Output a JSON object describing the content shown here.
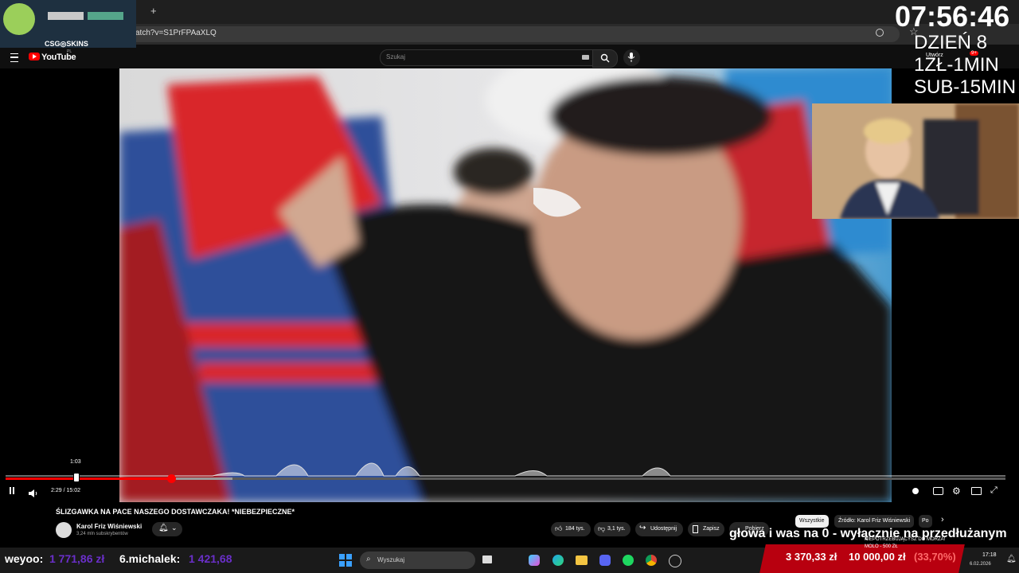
{
  "browser": {
    "url_fragment": "atch?v=S1PrFPAaXLQ",
    "new_tab_label": "+"
  },
  "youtube": {
    "logo_text": "YouTube",
    "region": "PL",
    "search_placeholder": "Szukaj",
    "create_label": "Utwórz",
    "notifications_badge": "9+"
  },
  "overlay": {
    "clock": "07:56:46",
    "day": "DZIEŃ 8",
    "price1": "1ZŁ-1MIN",
    "price2": "SUB-15MIN",
    "sponsor": "CSG◎SKINS",
    "subtitle": "głowa i was na 0 - wyłącznie na przedłużanym",
    "donor1_name": "weyoo:",
    "donor1_value": "1 771,86 zł",
    "donor2_name": "6.michalek:",
    "donor2_value": "1 421,68",
    "goal_current": "3 370,33 zł",
    "goal_target": "10 000,00 zł",
    "goal_percent": "(33,70%)",
    "goal_overlay_line1": "NIEPOTRZEBUJĄCYSZ DO MORZA!",
    "goal_overlay_line2": "MOLO - 500 ZŁ"
  },
  "player": {
    "hover_time": "1:03",
    "current_time": "2:29",
    "duration": "15:02",
    "time_display": "2:29 / 15:02",
    "progress_fraction": 0.166,
    "buffered_fraction": 0.227
  },
  "video_info": {
    "title": "ŚLIZGAWKA NA PACE NASZEGO DOSTAWCZAKA! *NIEBEZPIECZNE*",
    "channel": "Karol Friz Wiśniewski",
    "subscribers": "3,24 mln subskrybentów",
    "likes": "184 tys.",
    "dislikes": "3,1 tys.",
    "share": "Udostępnij",
    "save": "Zapisz",
    "more": "Pobierz"
  },
  "chips": [
    "Wszystkie",
    "Źródło: Karol Friz Wiśniewski",
    "Po"
  ],
  "taskbar": {
    "search_placeholder": "Wyszukaj",
    "time": "17:18",
    "date": "6.02.2026"
  }
}
